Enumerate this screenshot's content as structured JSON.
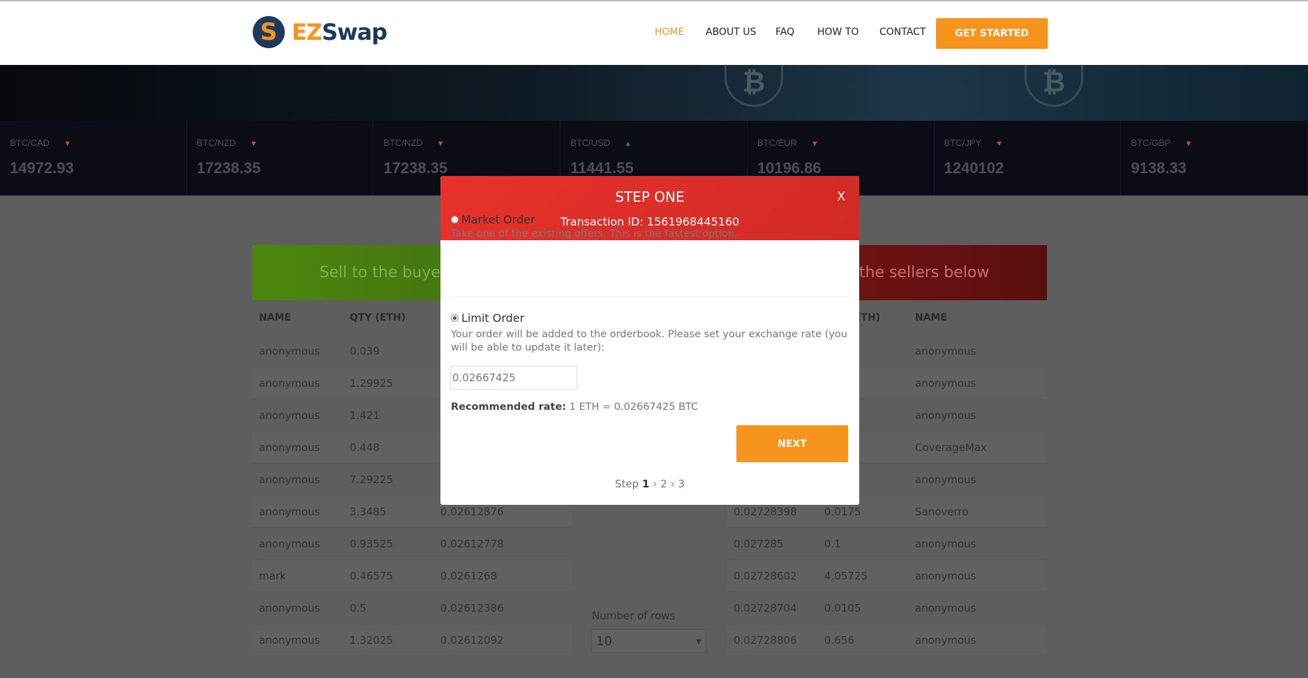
{
  "header": {
    "logo_mark": "S",
    "logo_text_a": "EZ",
    "logo_text_b": "Swap",
    "nav": [
      {
        "label": "HOME",
        "active": true
      },
      {
        "label": "ABOUT US"
      },
      {
        "label": "FAQ"
      },
      {
        "label": "HOW TO"
      },
      {
        "label": "CONTACT"
      }
    ],
    "cta": "GET STARTED",
    "accent": "#f7941d"
  },
  "ticker": [
    {
      "pair": "BTC/CAD",
      "dir": "down",
      "value": "14972.93"
    },
    {
      "pair": "BTC/NZD",
      "dir": "down",
      "value": "17238.35"
    },
    {
      "pair": "BTC/NZD",
      "dir": "down",
      "value": "17238.35"
    },
    {
      "pair": "BTC/USD",
      "dir": "up",
      "value": "11441.55"
    },
    {
      "pair": "BTC/EUR",
      "dir": "down",
      "value": "10196.86"
    },
    {
      "pair": "BTC/JPY",
      "dir": "down",
      "value": "1240102"
    },
    {
      "pair": "BTC/GBP",
      "dir": "down",
      "value": "9138.33"
    }
  ],
  "buy_panel": {
    "title": "Sell to the buyers below",
    "headers": [
      "NAME",
      "QTY (ETH)",
      ""
    ],
    "rows": [
      [
        "anonymous",
        "0.039",
        ""
      ],
      [
        "anonymous",
        "1.29925",
        ""
      ],
      [
        "anonymous",
        "1.421",
        ""
      ],
      [
        "anonymous",
        "0.448",
        ""
      ],
      [
        "anonymous",
        "7.29225",
        ""
      ],
      [
        "anonymous",
        "3.3485",
        "0.02612876"
      ],
      [
        "anonymous",
        "0.93525",
        "0.02612778"
      ],
      [
        "mark",
        "0.46575",
        "0.0261268"
      ],
      [
        "anonymous",
        "0.5",
        "0.02612386"
      ],
      [
        "anonymous",
        "1.32025",
        "0.02612092"
      ]
    ]
  },
  "sell_panel": {
    "title": "Buy from the sellers below",
    "headers": [
      "",
      "QTY (ETH)",
      "NAME"
    ],
    "rows": [
      [
        "",
        "",
        "anonymous"
      ],
      [
        "",
        "",
        "anonymous"
      ],
      [
        "",
        "",
        "anonymous"
      ],
      [
        "",
        "",
        "CoverageMax"
      ],
      [
        "",
        "",
        "anonymous"
      ],
      [
        "0.02728398",
        "0.0175",
        "Sanoverro"
      ],
      [
        "0.027285",
        "0.1",
        "anonymous"
      ],
      [
        "0.02728602",
        "4.05725",
        "anonymous"
      ],
      [
        "0.02728704",
        "0.0105",
        "anonymous"
      ],
      [
        "0.02728806",
        "0.656",
        "anonymous"
      ]
    ]
  },
  "rows_control": {
    "label": "Number of rows",
    "value": "10"
  },
  "modal": {
    "title": "STEP ONE",
    "transaction": "Transaction ID: 1561968445160",
    "close": "X",
    "market": {
      "label": "Market Order",
      "desc": "Take one of the existing offers. This is the fastest option.",
      "selected": false
    },
    "limit": {
      "label": "Limit Order",
      "desc": "Your order will be added to the orderbook. Please set your exchange rate (you will be able to update it later):",
      "selected": true
    },
    "rate_value": "0.02667425",
    "rec_label": "Recommended rate:",
    "rec_value": "1 ETH = 0.02667425 BTC",
    "next": "NEXT",
    "steps": {
      "prefix": "Step",
      "s1": "1",
      "s2": "2",
      "s3": "3"
    }
  }
}
